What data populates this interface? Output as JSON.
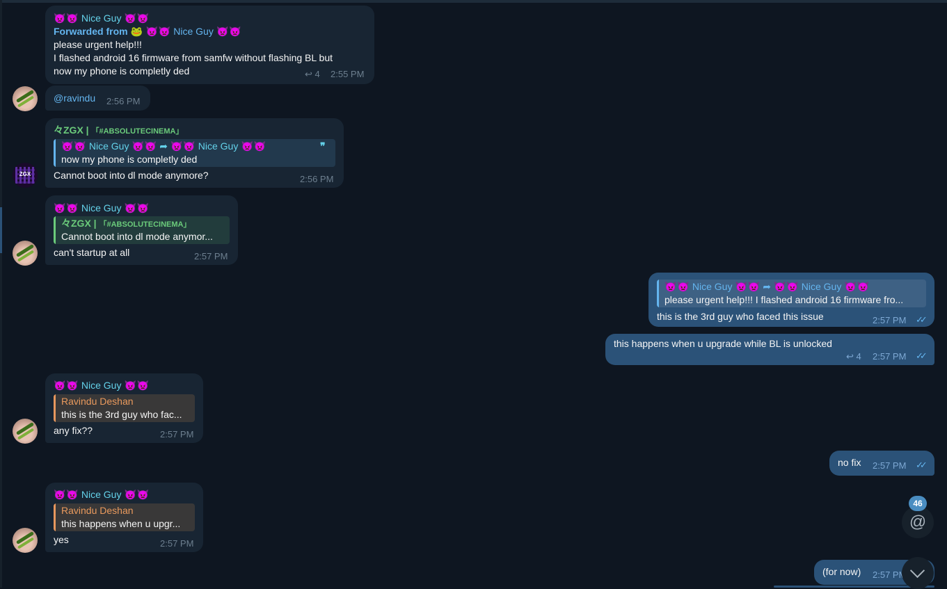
{
  "devil": "👿",
  "fwd_emoji": "🐸",
  "icons": {
    "reply": "reply-icon",
    "quote": "quote-icon",
    "forward": "forward-arrow-icon",
    "read": "double-check-icon",
    "mention": "mention-icon",
    "scroll": "chevron-down-icon"
  },
  "messages": {
    "m1": {
      "sender": "Nice Guy",
      "forwarded_label": "Forwarded from",
      "forwarded_name": "Nice Guy",
      "line1": "please urgent help!!!",
      "line2": "I flashed android 16 firmware from samfw without flashing BL but",
      "line3": "now my phone is completly ded",
      "reply_count": "4",
      "time": "2:55 PM"
    },
    "m2": {
      "text": "@ravindu",
      "time": "2:56 PM"
    },
    "m3": {
      "sender": "々ZGX | 「#ABSOLUTECINEMA」",
      "sender_pre": "々ZGX |",
      "sender_tag": "「#ABSOLUTECINEMA」",
      "reply_name_a": "Nice Guy",
      "reply_name_b": "Nice Guy",
      "reply_text": "now my phone is completly ded",
      "quote_mark": "❞",
      "text": "Cannot boot into dl mode anymore?",
      "time": "2:56 PM"
    },
    "m4": {
      "sender": "Nice Guy",
      "reply_pre": "々ZGX |",
      "reply_tag": "「#ABSOLUTECINEMA」",
      "reply_text": "Cannot boot into dl mode anymor...",
      "text": "can't startup at all",
      "time": "2:57 PM"
    },
    "m5": {
      "reply_name_a": "Nice Guy",
      "reply_name_b": "Nice Guy",
      "reply_text": "please urgent help!!! I flashed android 16 firmware fro...",
      "text": "this is the 3rd guy who faced this issue",
      "time": "2:57 PM"
    },
    "m6": {
      "text": "this happens when u upgrade while BL is unlocked",
      "reply_count": "4",
      "time": "2:57 PM"
    },
    "m7": {
      "sender": "Nice Guy",
      "reply_name": "Ravindu Deshan",
      "reply_text": "this is the 3rd guy who fac...",
      "text": "any fix??",
      "time": "2:57 PM"
    },
    "m8": {
      "text": "no fix",
      "time": "2:57 PM"
    },
    "m9": {
      "sender": "Nice Guy",
      "reply_name": "Ravindu Deshan",
      "reply_text": "this happens when u upgr...",
      "text": "yes",
      "time": "2:57 PM"
    },
    "m10": {
      "text": "(for now)",
      "time": "2:57 PM"
    }
  },
  "mention_badge": "46",
  "colors": {
    "background": "#0e1621",
    "incoming": "#182533",
    "outgoing": "#2b5278",
    "accent": "#64b5ef"
  }
}
